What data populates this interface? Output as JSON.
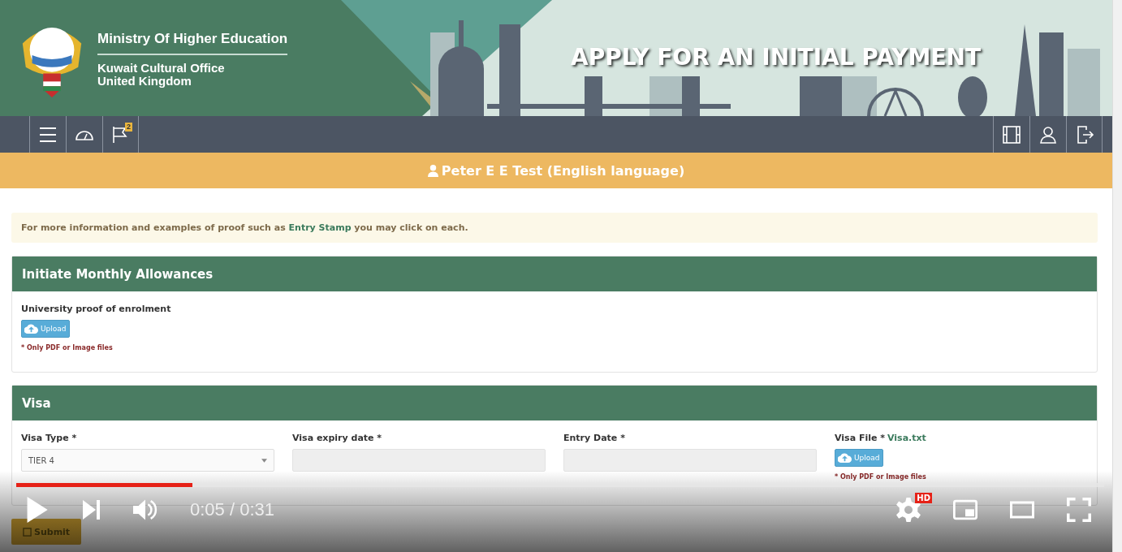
{
  "header": {
    "ministry": "Ministry Of Higher Education",
    "office_lines": [
      "Kuwait Cultural Office",
      "United Kingdom"
    ],
    "page_title": "APPLY FOR AN INITIAL PAYMENT"
  },
  "nav": {
    "left": [
      {
        "kind": "menu"
      },
      {
        "kind": "dashboard"
      },
      {
        "kind": "flag",
        "badge": "2"
      }
    ],
    "right": [
      {
        "kind": "film"
      },
      {
        "kind": "user"
      },
      {
        "kind": "logout"
      }
    ]
  },
  "user_bar": {
    "name": "Peter E E Test (English language)"
  },
  "info": {
    "before": "For more information and examples of proof such as",
    "link": "Entry Stamp",
    "after": "you may click on each."
  },
  "panels": [
    {
      "title": "Initiate Monthly Allowances",
      "fields": [
        {
          "kind": "upload",
          "label": "University proof of enrolment",
          "button": "Upload",
          "note": "* Only PDF or Image files"
        }
      ]
    },
    {
      "title": "Visa",
      "fields": [
        {
          "kind": "select",
          "label": "Visa Type  *",
          "value": "TIER 4"
        },
        {
          "kind": "input",
          "label": "Visa expiry date  *"
        },
        {
          "kind": "input",
          "label": "Entry Date  *"
        },
        {
          "kind": "upload",
          "label": "Visa File *",
          "file": "Visa.txt",
          "button": "Upload",
          "note": "* Only PDF or Image files"
        }
      ]
    }
  ],
  "submit": "Submit",
  "player": {
    "level": 0.162,
    "time": "0:05 / 0:31",
    "quality": "HD"
  }
}
